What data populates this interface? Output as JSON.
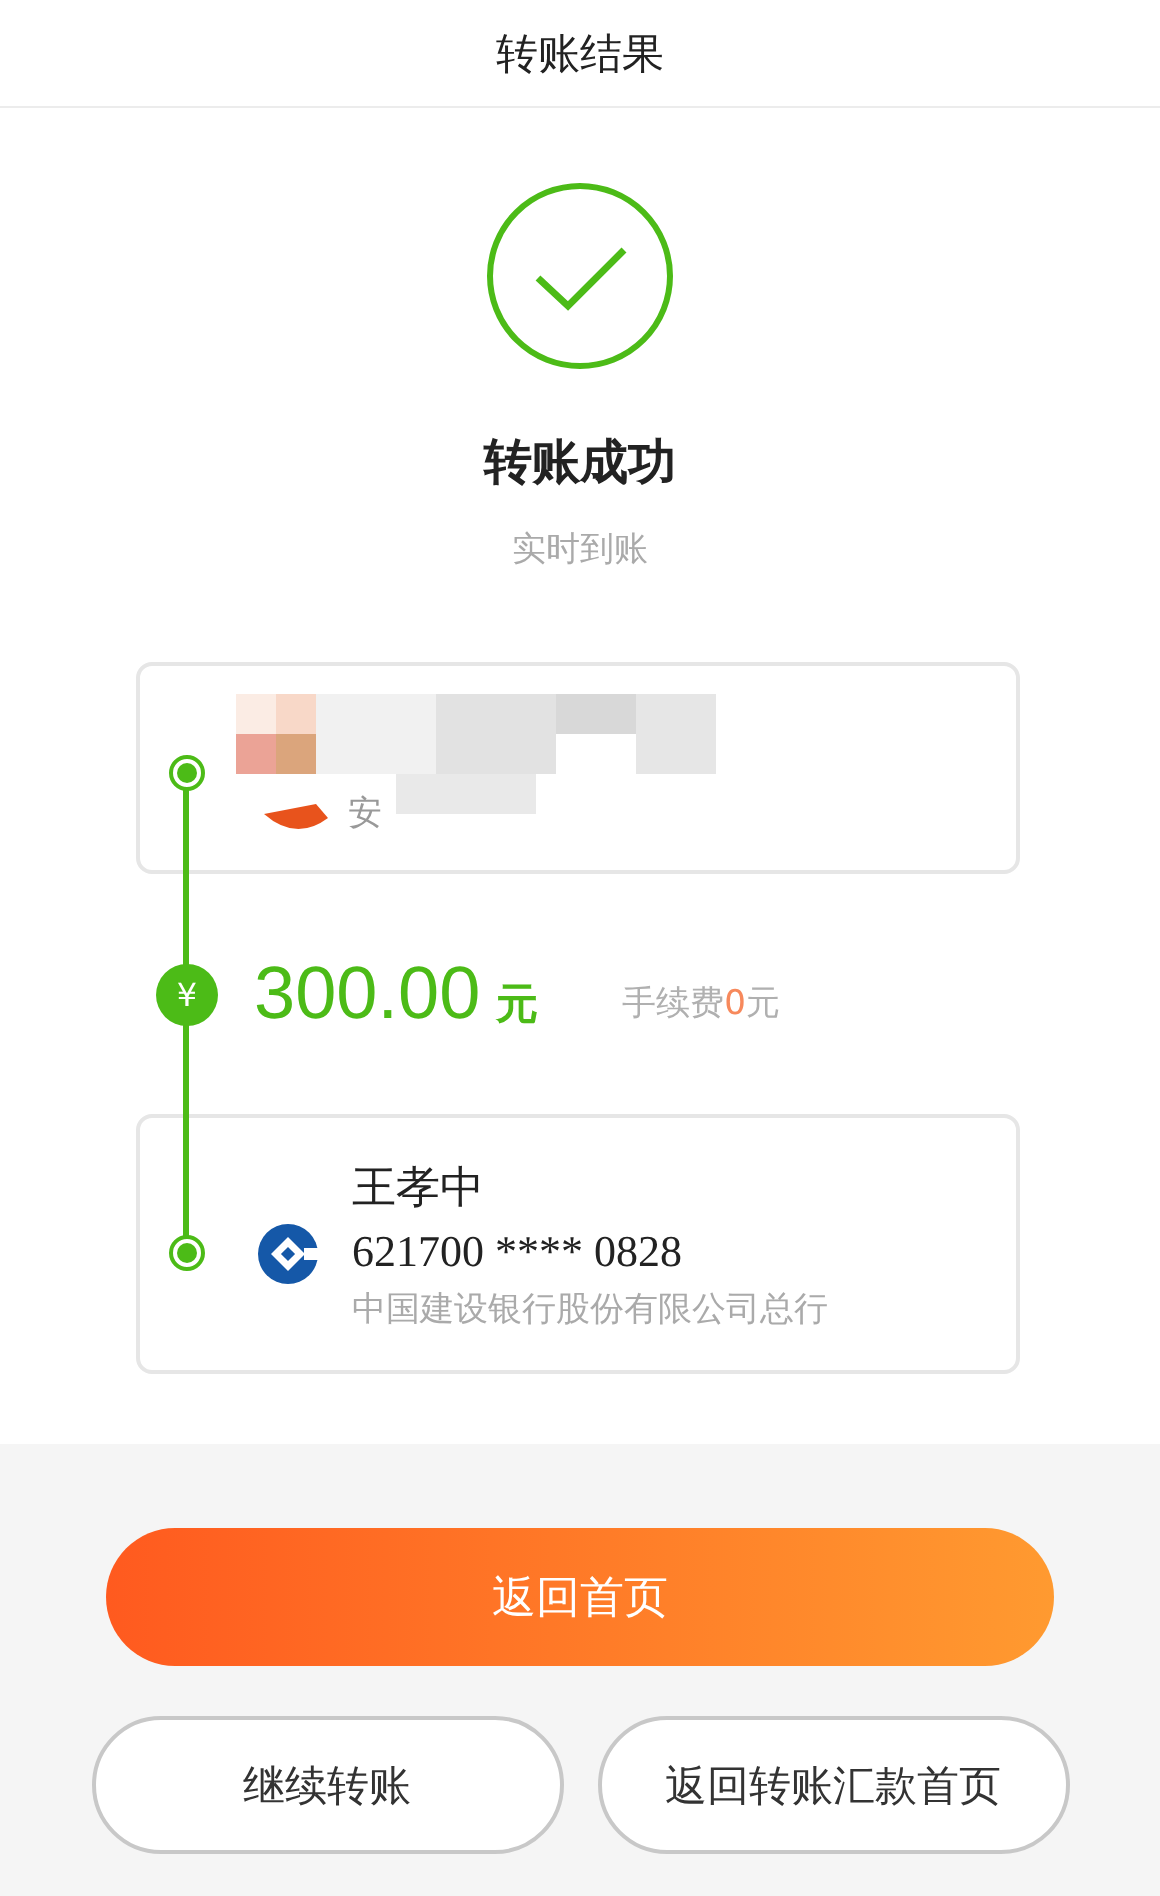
{
  "header": {
    "title": "转账结果"
  },
  "result": {
    "status": "转账成功",
    "subtitle": "实时到账"
  },
  "payer": {
    "visible_text": "安"
  },
  "transfer": {
    "currency_icon": "¥",
    "amount": "300.00",
    "unit": "元",
    "fee_label": "手续费",
    "fee_value": "0",
    "fee_unit": "元"
  },
  "payee": {
    "name": "王孝中",
    "account": "621700 **** 0828",
    "bank": "中国建设银行股份有限公司总行"
  },
  "buttons": [
    {
      "label": "返回首页",
      "kind": "primary"
    },
    {
      "label": "继续转账",
      "kind": "outline"
    },
    {
      "label": "返回转账汇款首页",
      "kind": "outline"
    }
  ]
}
